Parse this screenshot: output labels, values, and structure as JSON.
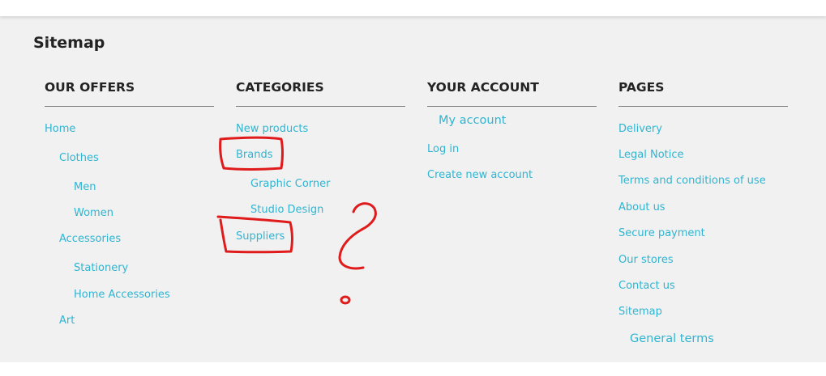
{
  "page": {
    "title": "Sitemap"
  },
  "columns": {
    "offers": {
      "heading": "OUR OFFERS",
      "links": {
        "home": "Home",
        "clothes": "Clothes",
        "men": "Men",
        "women": "Women",
        "accessories": "Accessories",
        "stationery": "Stationery",
        "home_accessories": "Home Accessories",
        "art": "Art"
      }
    },
    "categories": {
      "heading": "CATEGORIES",
      "links": {
        "new_products": "New products",
        "brands": "Brands",
        "graphic_corner": "Graphic Corner",
        "studio_design": "Studio Design",
        "suppliers": "Suppliers"
      }
    },
    "account": {
      "heading": "YOUR ACCOUNT",
      "links": {
        "my_account": "My account",
        "log_in": "Log in",
        "create_account": "Create new account"
      }
    },
    "pages": {
      "heading": "PAGES",
      "links": {
        "delivery": "Delivery",
        "legal_notice": "Legal Notice",
        "terms": "Terms and conditions of use",
        "about_us": "About us",
        "secure_payment": "Secure payment",
        "our_stores": "Our stores",
        "contact_us": "Contact us",
        "sitemap": "Sitemap",
        "general_terms": "General terms"
      }
    }
  },
  "colors": {
    "link": "#2fb5d2",
    "heading": "#232323",
    "panel_background": "#f1f1f1",
    "annotation": "#e01b1b"
  }
}
